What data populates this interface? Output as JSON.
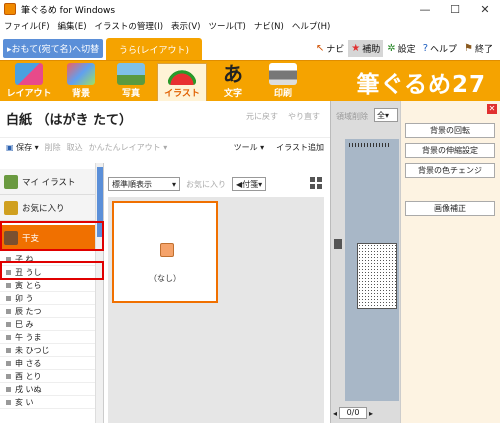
{
  "window": {
    "title": "筆ぐるめ for Windows",
    "minimize": "—",
    "maximize": "☐",
    "close": "✕"
  },
  "menu": [
    "ファイル(F)",
    "編集(E)",
    "イラストの管理(I)",
    "表示(V)",
    "ツール(T)",
    "ナビ(N)",
    "ヘルプ(H)"
  ],
  "mode": {
    "tab1": "▸おもて(宛て名)へ切替",
    "tab2": "うら(レイアウト)",
    "right": [
      {
        "icon": "arrow-icon",
        "glyph": "↖",
        "label": "ナビ",
        "active": false
      },
      {
        "icon": "star-icon",
        "glyph": "★",
        "label": "補助",
        "active": true
      },
      {
        "icon": "gear-icon",
        "glyph": "✲",
        "label": "設定",
        "active": false
      },
      {
        "icon": "help-icon",
        "glyph": "?",
        "label": "ヘルプ",
        "active": false
      },
      {
        "icon": "exit-icon",
        "glyph": "⚑",
        "label": "終了",
        "active": false
      }
    ]
  },
  "toolbar": {
    "items": [
      "レイアウト",
      "背景",
      "写真",
      "イラスト",
      "文字",
      "印刷"
    ],
    "active": "イラスト",
    "brand": "筆ぐるめ27"
  },
  "doc": {
    "title": "白紙 （はがき たて）",
    "undo": "元に戻す",
    "redo": "やり直す"
  },
  "left_bar": {
    "save": "保存 ▾",
    "delete": "削除",
    "scan": "取込",
    "easy_layout": "かんたんレイアウト ▾",
    "tools": "ツール ▾",
    "add_illust": "イラスト追加"
  },
  "categories": {
    "my_illust": "マイ イラスト",
    "favorites": "お気に入り",
    "eto": "干支",
    "subitems": [
      "子 ね",
      "丑 うし",
      "寅 とら",
      "卯 う",
      "辰 たつ",
      "巳 み",
      "午 うま",
      "未 ひつじ",
      "申 さる",
      "酉 とり",
      "戌 いぬ",
      "亥 い"
    ]
  },
  "gallery": {
    "sort": "標準順表示",
    "fav_add": "お気に入り",
    "tag": "付箋",
    "item_label": "（なし）"
  },
  "mid": {
    "clear": "領域削除",
    "select": "全",
    "page": "0/0"
  },
  "right_panel": {
    "buttons": [
      "背景の回転",
      "背景の伸縮設定",
      "背景の色チェンジ",
      "画像補正"
    ]
  },
  "colors": {
    "orange": "#f5a300",
    "accent": "#f07000",
    "blue": "#5b8fd8",
    "highlight": "#e00000"
  }
}
